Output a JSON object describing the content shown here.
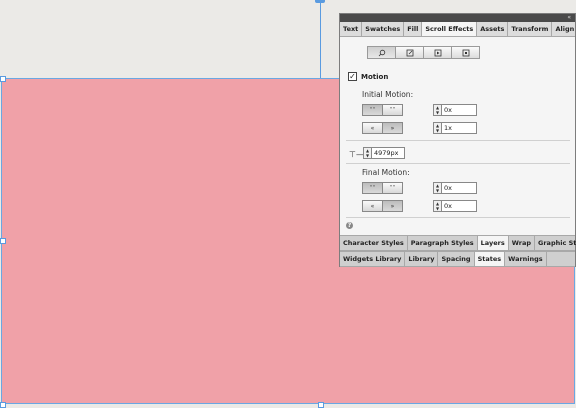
{
  "panel": {
    "top_tabs": [
      "Text",
      "Swatches",
      "Fill",
      "Scroll Effects",
      "Assets",
      "Transform",
      "Align"
    ],
    "active_top_tab": "Scroll Effects",
    "mode_icons": [
      "motion-icon",
      "resize-icon",
      "slideshow-icon",
      "widget-icon"
    ],
    "motion": {
      "checkbox_label": "Motion",
      "checked": true,
      "initial": {
        "title": "Initial Motion:",
        "vertical_value": "0x",
        "horizontal_value": "1x"
      },
      "key_position": {
        "value": "4979px"
      },
      "final": {
        "title": "Final Motion:",
        "vertical_value": "0x",
        "horizontal_value": "0x"
      }
    },
    "bottom_tabs_1": [
      "Character Styles",
      "Paragraph Styles",
      "Layers",
      "Wrap",
      "Graphic Styles"
    ],
    "active_bottom_tab_1": "Layers",
    "bottom_tabs_2": [
      "Widgets Library",
      "Library",
      "Spacing",
      "States",
      "Warnings"
    ],
    "active_bottom_tab_2": "States"
  },
  "colors": {
    "rect_fill": "#f0a1a8",
    "selection": "#5a9be0",
    "panel_bg": "#f5f5f5"
  }
}
